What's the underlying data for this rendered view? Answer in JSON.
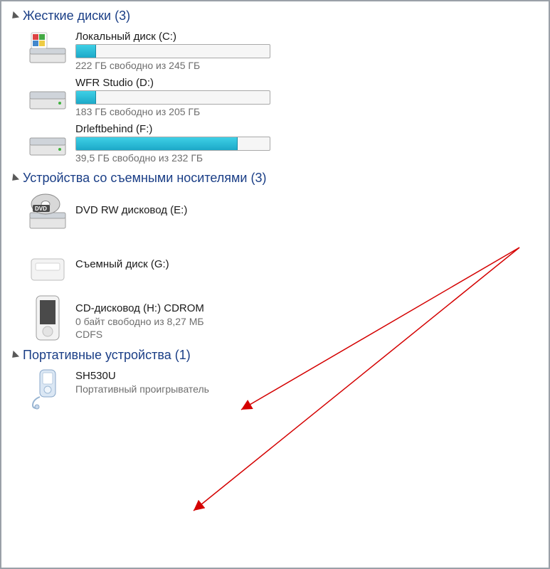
{
  "sections": [
    {
      "title": "Жесткие диски (3)"
    },
    {
      "title": "Устройства со съемными носителями (3)"
    },
    {
      "title": "Портативные устройства (1)"
    }
  ],
  "hdd": [
    {
      "name": "Локальный диск (C:)",
      "status": "222 ГБ свободно из 245 ГБ",
      "fill": 10
    },
    {
      "name": "WFR Studio (D:)",
      "status": "183 ГБ свободно из 205 ГБ",
      "fill": 10
    },
    {
      "name": "Drleftbehind (F:)",
      "status": "39,5 ГБ свободно из 232 ГБ",
      "fill": 83
    }
  ],
  "removable": [
    {
      "name": "DVD RW дисковод (E:)"
    },
    {
      "name": "Съемный диск (G:)"
    },
    {
      "name": "CD-дисковод (H:) CDROM",
      "status": "0 байт свободно из 8,27 МБ",
      "fs": "CDFS"
    }
  ],
  "portable": [
    {
      "name": "SH530U",
      "type": "Портативный проигрыватель"
    }
  ]
}
